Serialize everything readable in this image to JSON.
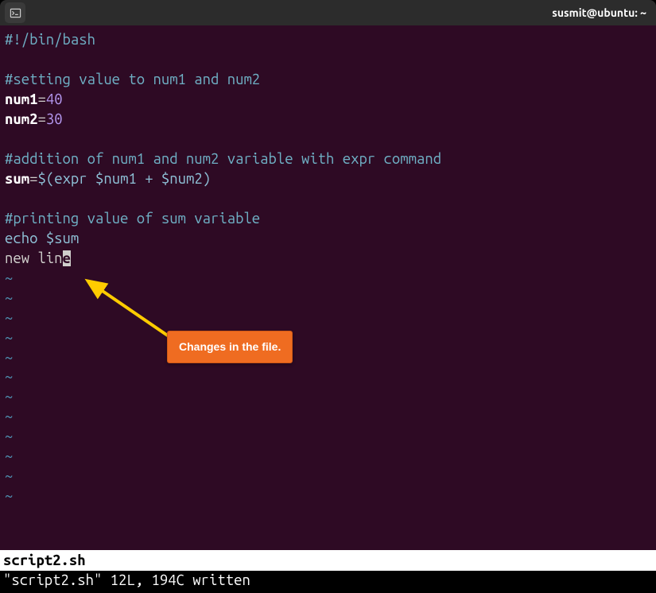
{
  "titlebar": {
    "title": "susmit@ubuntu: ~"
  },
  "code": {
    "line1": "#!/bin/bash",
    "line2": "",
    "line3": "#setting value to num1 and num2",
    "line4_var": "num1",
    "line4_val": "40",
    "line5_var": "num2",
    "line5_val": "30",
    "line6": "",
    "line7": "#addition of num1 and num2 variable with expr command",
    "line8_var": "sum",
    "line8_eval_open": "$(",
    "line8_cmd": "expr",
    "line8_arg1": " $num1 ",
    "line8_op": "+",
    "line8_arg2": " $num2",
    "line8_eval_close": ")",
    "line9": "",
    "line10": "#printing value of sum variable",
    "line11_cmd": "echo",
    "line11_arg": " $sum",
    "line12_pre": "new lin",
    "line12_cursor": "e"
  },
  "tilde": "~",
  "annotation": {
    "text": "Changes in the file."
  },
  "statusbar": {
    "filename": "script2.sh"
  },
  "cmdbar": {
    "text": "\"script2.sh\" 12L, 194C written"
  }
}
